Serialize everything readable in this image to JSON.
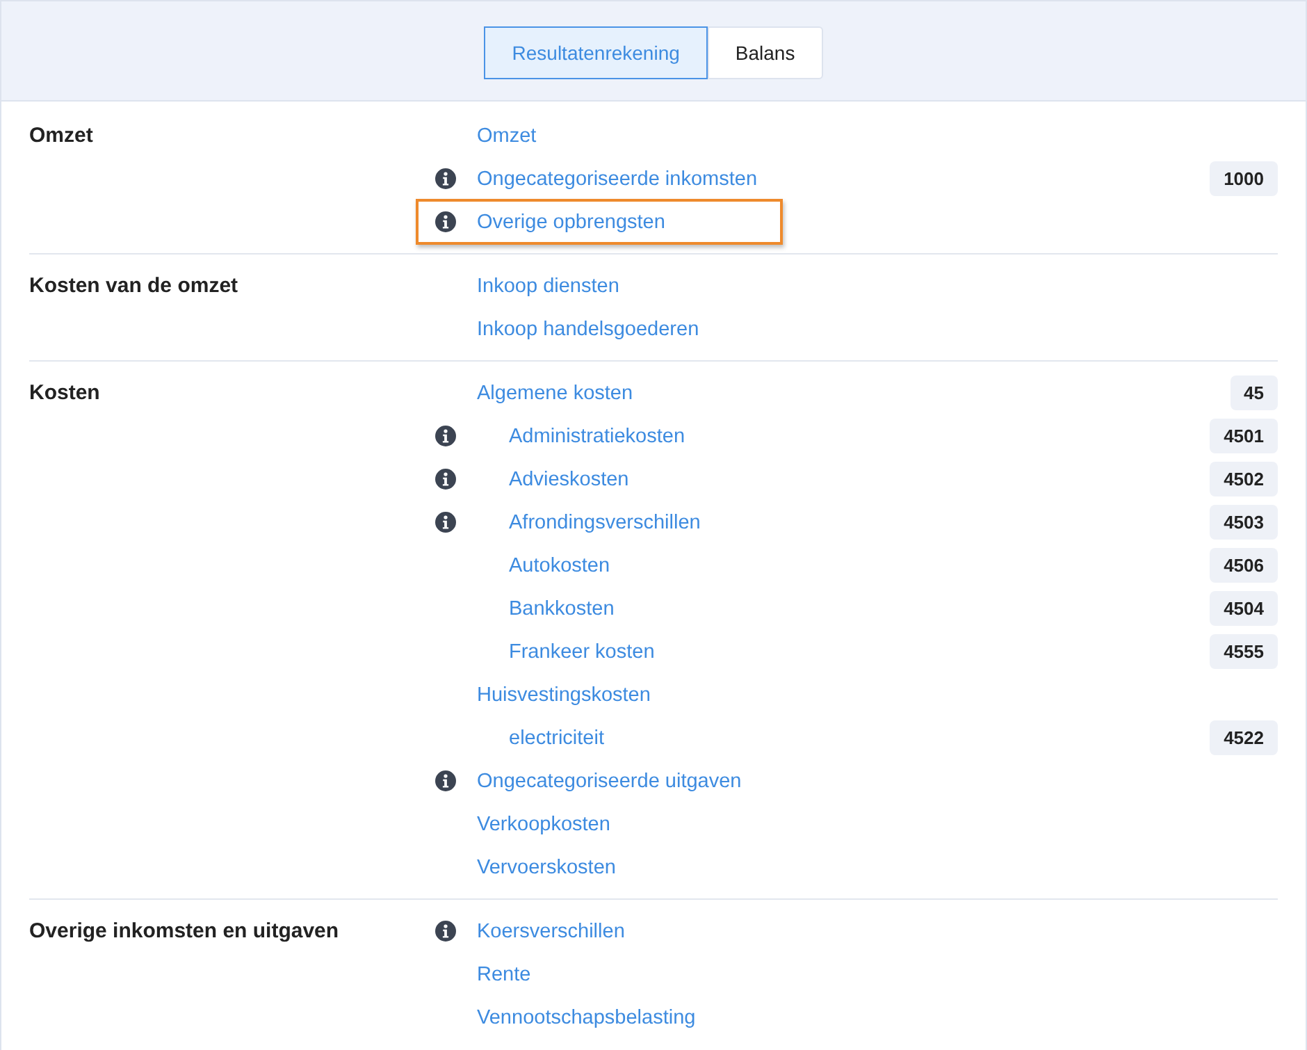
{
  "tabs": [
    {
      "label": "Resultatenrekening",
      "selected": true
    },
    {
      "label": "Balans",
      "selected": false
    }
  ],
  "sections": [
    {
      "title": "Omzet",
      "accounts": [
        {
          "name": "Omzet",
          "info": false,
          "highlighted": false
        },
        {
          "name": "Ongecategoriseerde inkomsten",
          "info": true,
          "highlighted": false,
          "code": "1000"
        },
        {
          "name": "Overige opbrengsten",
          "info": true,
          "highlighted": true
        }
      ]
    },
    {
      "title": "Kosten van de omzet",
      "accounts": [
        {
          "name": "Inkoop diensten",
          "info": false,
          "highlighted": false
        },
        {
          "name": "Inkoop handelsgoederen",
          "info": false,
          "highlighted": false
        }
      ]
    },
    {
      "title": "Kosten",
      "accounts": [
        {
          "name": "Algemene kosten",
          "info": false,
          "highlighted": false,
          "code": "45",
          "children": [
            {
              "name": "Administratiekosten",
              "info": true,
              "highlighted": false,
              "code": "4501"
            },
            {
              "name": "Advieskosten",
              "info": true,
              "highlighted": false,
              "code": "4502"
            },
            {
              "name": "Afrondingsverschillen",
              "info": true,
              "highlighted": false,
              "code": "4503"
            },
            {
              "name": "Autokosten",
              "info": false,
              "highlighted": false,
              "code": "4506"
            },
            {
              "name": "Bankkosten",
              "info": false,
              "highlighted": false,
              "code": "4504"
            },
            {
              "name": "Frankeer kosten",
              "info": false,
              "highlighted": false,
              "code": "4555"
            }
          ]
        },
        {
          "name": "Huisvestingskosten",
          "info": false,
          "highlighted": false,
          "children": [
            {
              "name": "electriciteit",
              "info": false,
              "highlighted": false,
              "code": "4522"
            }
          ]
        },
        {
          "name": "Ongecategoriseerde uitgaven",
          "info": true,
          "highlighted": false
        },
        {
          "name": "Verkoopkosten",
          "info": false,
          "highlighted": false
        },
        {
          "name": "Vervoerskosten",
          "info": false,
          "highlighted": false
        }
      ]
    },
    {
      "title": "Overige inkomsten en uitgaven",
      "accounts": [
        {
          "name": "Koersverschillen",
          "info": true,
          "highlighted": false
        },
        {
          "name": "Rente",
          "info": false,
          "highlighted": false
        },
        {
          "name": "Vennootschapsbelasting",
          "info": false,
          "highlighted": false
        }
      ]
    }
  ]
}
